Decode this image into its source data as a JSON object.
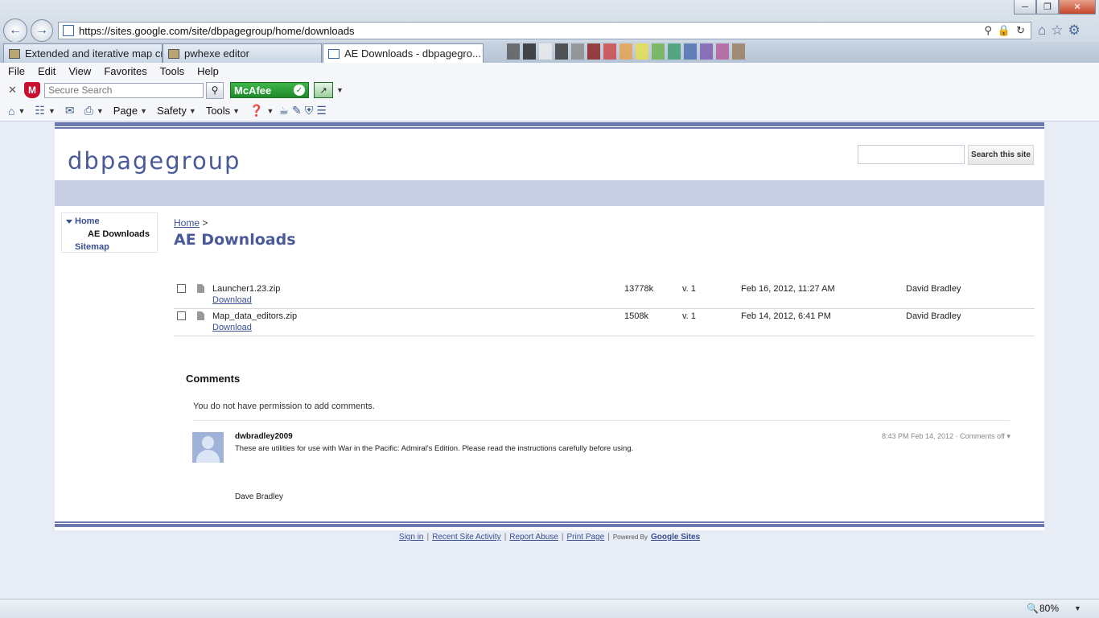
{
  "browser": {
    "url": "https://sites.google.com/site/dbpagegroup/home/downloads",
    "tabs": [
      {
        "label": "Extended and iterative map cre..."
      },
      {
        "label": "pwhexe editor"
      },
      {
        "label": "AE Downloads - dbpagegro..."
      }
    ],
    "menu": [
      "File",
      "Edit",
      "View",
      "Favorites",
      "Tools",
      "Help"
    ],
    "toolbar": {
      "search_placeholder": "Secure Search",
      "mcafee_label": "McAfee",
      "page_label": "Page",
      "safety_label": "Safety",
      "tools_label": "Tools"
    },
    "zoom": "80%"
  },
  "site": {
    "title": "dbpagegroup",
    "search_button": "Search this site",
    "nav": {
      "home": "Home",
      "ae_downloads": "AE Downloads",
      "sitemap": "Sitemap"
    },
    "breadcrumb": {
      "home": "Home",
      "sep": ">"
    },
    "page_title": "AE Downloads",
    "files": [
      {
        "name": "Launcher1.23.zip",
        "download": "Download",
        "size": "13778k",
        "version": "v. 1",
        "date": "Feb 16, 2012, 11:27 AM",
        "author": "David Bradley"
      },
      {
        "name": "Map_data_editors.zip",
        "download": "Download",
        "size": "1508k",
        "version": "v. 1",
        "date": "Feb 14, 2012, 6:41 PM",
        "author": "David Bradley"
      }
    ],
    "comments": {
      "heading": "Comments",
      "no_permission": "You do not have permission to add comments.",
      "items": [
        {
          "author": "dwbradley2009",
          "body": "These are utilities for use with War in the Pacific: Admiral's Edition. Please read the instructions carefully before using.",
          "meta": "8:43 PM Feb 14, 2012 · Comments off ▾",
          "signature": "Dave Bradley"
        }
      ]
    },
    "footer": {
      "sign_in": "Sign in",
      "recent_activity": "Recent Site Activity",
      "report_abuse": "Report Abuse",
      "print_page": "Print Page",
      "powered_by": "Powered By",
      "google_sites": "Google Sites"
    }
  }
}
